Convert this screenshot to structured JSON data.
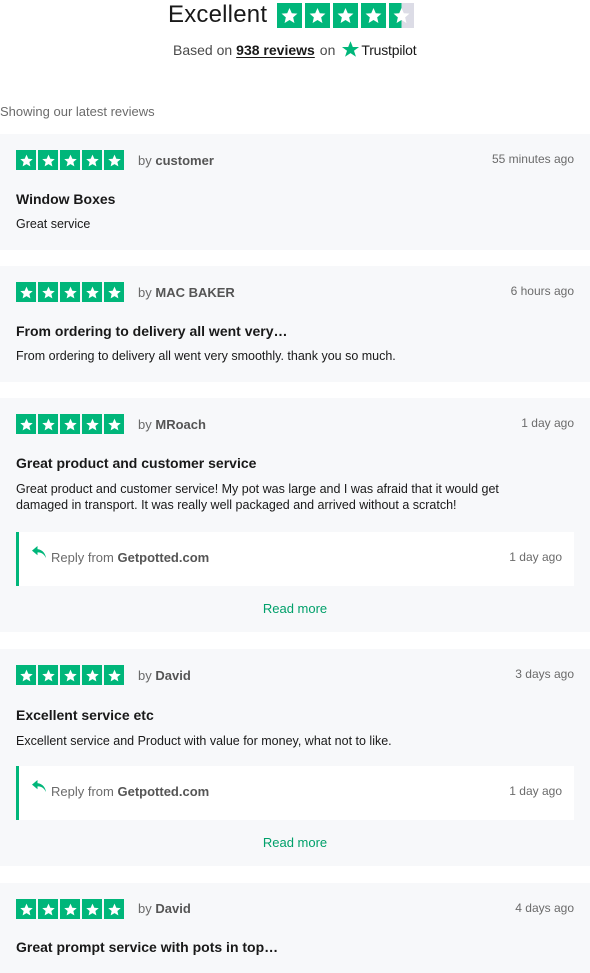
{
  "summary": {
    "rating_word": "Excellent",
    "rating_stars": 4.5,
    "based_on_prefix": "Based on",
    "review_count": "938 reviews",
    "on_word": "on",
    "brand": "Trustpilot",
    "brand_icon": "trustpilot-star-icon"
  },
  "list_heading": "Showing our latest reviews",
  "reviews": [
    {
      "stars": 5,
      "by_prefix": "by",
      "author": "customer",
      "time": "55 minutes ago",
      "title": "Window Boxes",
      "text": "Great service"
    },
    {
      "stars": 5,
      "by_prefix": "by",
      "author": "MAC BAKER",
      "time": "6 hours ago",
      "title": "From ordering to delivery all went very…",
      "text": "From ordering to delivery all went very smoothly. thank you so much."
    },
    {
      "stars": 5,
      "by_prefix": "by",
      "author": "MRoach",
      "time": "1 day ago",
      "title": "Great product and customer service",
      "text": "Great product and customer service! My pot was large and I was afraid that it would get damaged in transport. It was really well packaged and arrived without a scratch!",
      "reply": {
        "prefix": "Reply from",
        "company": "Getpotted.com",
        "time": "1 day ago"
      },
      "read_more": "Read more"
    },
    {
      "stars": 5,
      "by_prefix": "by",
      "author": "David",
      "time": "3 days ago",
      "title": "Excellent service etc",
      "text": "Excellent service and Product with value for money, what not to like.",
      "reply": {
        "prefix": "Reply from",
        "company": "Getpotted.com",
        "time": "1 day ago"
      },
      "read_more": "Read more"
    },
    {
      "stars": 5,
      "by_prefix": "by",
      "author": "David",
      "time": "4 days ago",
      "title": "Great prompt service with pots in top…"
    }
  ],
  "colors": {
    "accent": "#00b67a",
    "link": "#00a06a",
    "card_bg": "#f7f8fa"
  }
}
